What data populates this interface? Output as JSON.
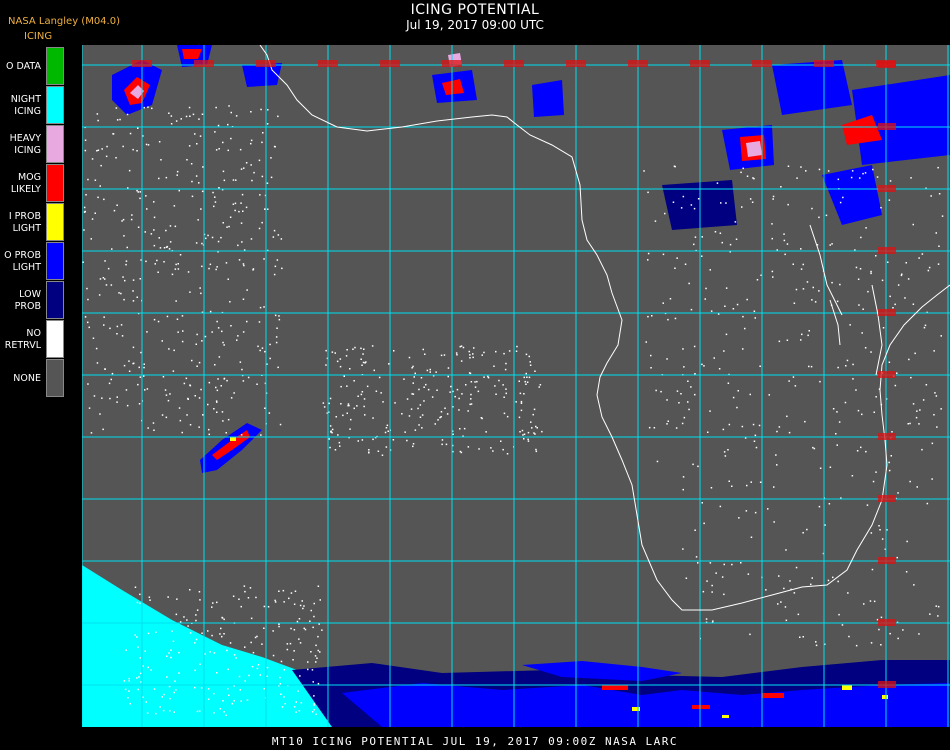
{
  "header": {
    "title": "ICING POTENTIAL",
    "timestamp": "Jul 19, 2017 09:00 UTC",
    "brand": "NASA Langley (M04.0)",
    "brand_sub": "ICING"
  },
  "legend": {
    "items": [
      {
        "lines": [
          "O DATA"
        ],
        "color": "#00b800"
      },
      {
        "lines": [
          "NIGHT",
          "ICING"
        ],
        "color": "#00ffff"
      },
      {
        "lines": [
          "HEAVY",
          "ICING"
        ],
        "color": "#e8a8e0"
      },
      {
        "lines": [
          "MOG",
          "LIKELY"
        ],
        "color": "#ff0000"
      },
      {
        "lines": [
          "I PROB",
          "LIGHT"
        ],
        "color": "#ffff00"
      },
      {
        "lines": [
          "O PROB",
          "LIGHT"
        ],
        "color": "#0000ff"
      },
      {
        "lines": [
          "LOW",
          "PROB"
        ],
        "color": "#000080"
      },
      {
        "lines": [
          "NO",
          "RETRVL"
        ],
        "color": "#ffffff"
      },
      {
        "lines": [
          "NONE"
        ],
        "color": "#555555"
      }
    ]
  },
  "map": {
    "background_color": "#555555",
    "grid_color": "#00e0f0",
    "label_color": "#e01010",
    "coast_color": "#ffffff"
  },
  "footer": {
    "text": "MT10  ICING POTENTIAL   JUL 19, 2017 09:00Z   NASA LARC"
  }
}
